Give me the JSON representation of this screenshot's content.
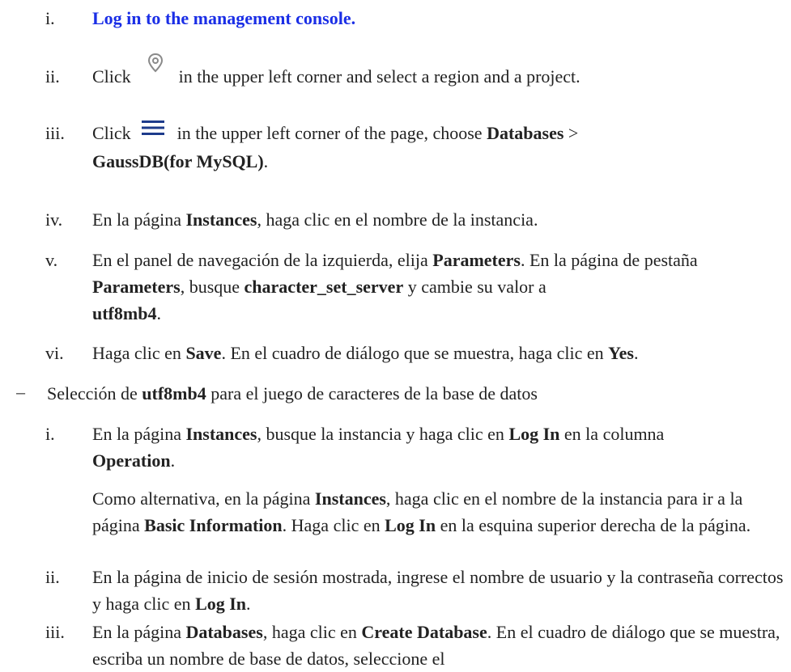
{
  "steps_a": [
    {
      "num": "i.",
      "link": "Log in to the management console."
    },
    {
      "num": "ii.",
      "pre": "Click",
      "icon": "location-pin-icon",
      "post": "in the upper left corner and select a region and a project."
    },
    {
      "num": "iii.",
      "pre": "Click",
      "icon": "hamburger-menu-icon",
      "post": "in the upper left corner of the page, choose",
      "b1": "Databases",
      "sep": ">",
      "b2": "GaussDB(for MySQL)",
      "end": "."
    },
    {
      "num": "iv.",
      "t1": "En la página",
      "b1": "Instances",
      "t2": ", haga clic en el nombre de la instancia."
    },
    {
      "num": "v.",
      "t1": "En el panel de navegación de la izquierda, elija",
      "b1": "Parameters",
      "t2": ". En la página de pestaña",
      "b2": "Parameters",
      "t3": ", busque",
      "b3": "character_set_server",
      "t4": "y cambie su valor a",
      "b4": "utf8mb4",
      "t5": "."
    },
    {
      "num": "vi.",
      "t1": "Haga clic en",
      "b1": "Save",
      "t2": ". En el cuadro de diálogo que se muestra, haga clic en",
      "b2": "Yes",
      "t3": "."
    }
  ],
  "bullet": {
    "dash": "–",
    "t1": "Selección de",
    "b1": "utf8mb4",
    "t2": "para el juego de caracteres de la base de datos"
  },
  "steps_b": [
    {
      "num": "i.",
      "t1": "En la página",
      "b1": "Instances",
      "t2": ", busque la instancia y haga clic en",
      "b2": "Log In",
      "t3": "en la columna",
      "b3": "Operation",
      "t4": ".",
      "p2_t1": "Como alternativa, en la página",
      "p2_b1": "Instances",
      "p2_t2": ", haga clic en el nombre de la instancia para ir a la página",
      "p2_b2": "Basic Information",
      "p2_t3": ". Haga clic en",
      "p2_b3": "Log In",
      "p2_t4": "en la esquina superior derecha de la página."
    },
    {
      "num": "ii.",
      "t1": "En la página de inicio de sesión mostrada, ingrese el nombre de usuario y la contraseña correctos y haga clic en",
      "b1": "Log In",
      "t2": "."
    },
    {
      "num": "iii.",
      "t1": "En la página",
      "b1": "Databases",
      "t2": ", haga clic en",
      "b2": "Create Database",
      "t3": ". En el cuadro de diálogo que se muestra, escriba un nombre de base de datos, seleccione el"
    }
  ],
  "colors": {
    "link": "#1a2ee6",
    "text": "#222222"
  }
}
